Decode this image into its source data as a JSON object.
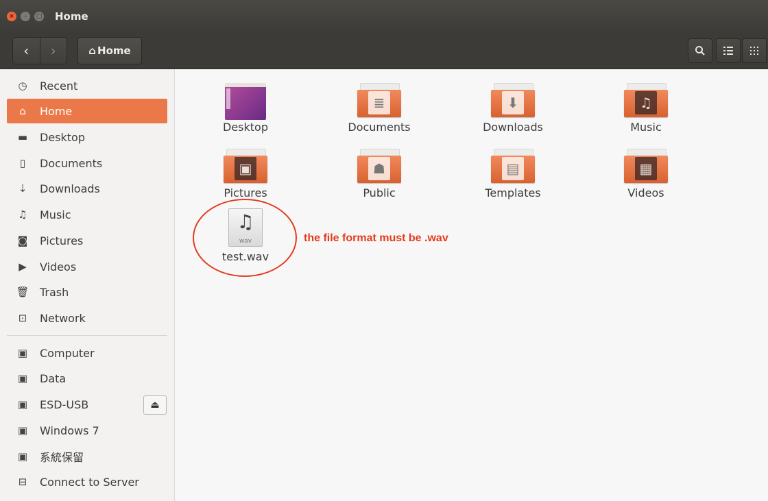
{
  "window": {
    "title": "Home",
    "controls": [
      "close",
      "minimize",
      "maximize"
    ]
  },
  "toolbar": {
    "back_icon": "chevron-left-icon",
    "forward_icon": "chevron-right-icon",
    "path_label": "Home",
    "path_icon": "home-icon",
    "buttons": [
      "search-icon",
      "list-view-icon",
      "grid-view-icon"
    ]
  },
  "sidebar": {
    "items": [
      {
        "label": "Recent",
        "icon": "clock-icon"
      },
      {
        "label": "Home",
        "icon": "home-icon",
        "active": true
      },
      {
        "label": "Desktop",
        "icon": "folder-icon"
      },
      {
        "label": "Documents",
        "icon": "document-icon"
      },
      {
        "label": "Downloads",
        "icon": "download-icon"
      },
      {
        "label": "Music",
        "icon": "music-icon"
      },
      {
        "label": "Pictures",
        "icon": "camera-icon"
      },
      {
        "label": "Videos",
        "icon": "video-icon"
      },
      {
        "label": "Trash",
        "icon": "trash-icon"
      },
      {
        "label": "Network",
        "icon": "network-icon"
      }
    ],
    "devices": [
      {
        "label": "Computer",
        "icon": "drive-icon"
      },
      {
        "label": "Data",
        "icon": "drive-icon"
      },
      {
        "label": "ESD-USB",
        "icon": "drive-icon",
        "eject": true
      },
      {
        "label": "Windows 7",
        "icon": "drive-icon"
      },
      {
        "label": "系統保留",
        "icon": "drive-icon"
      },
      {
        "label": "Connect to Server",
        "icon": "server-icon"
      }
    ],
    "active_color": "#ea7849"
  },
  "content": {
    "items": [
      {
        "label": "Desktop",
        "icon": "desktop-folder-icon"
      },
      {
        "label": "Documents",
        "icon": "documents-folder-icon"
      },
      {
        "label": "Downloads",
        "icon": "downloads-folder-icon"
      },
      {
        "label": "Music",
        "icon": "music-folder-icon"
      },
      {
        "label": "Pictures",
        "icon": "pictures-folder-icon"
      },
      {
        "label": "Public",
        "icon": "public-folder-icon"
      },
      {
        "label": "Templates",
        "icon": "templates-folder-icon"
      },
      {
        "label": "Videos",
        "icon": "videos-folder-icon"
      },
      {
        "label": "test.wav",
        "icon": "audio-file-icon",
        "file_ext": "wav"
      }
    ]
  },
  "annotation": {
    "text": "the file format must be .wav",
    "color": "#e43b1c"
  }
}
